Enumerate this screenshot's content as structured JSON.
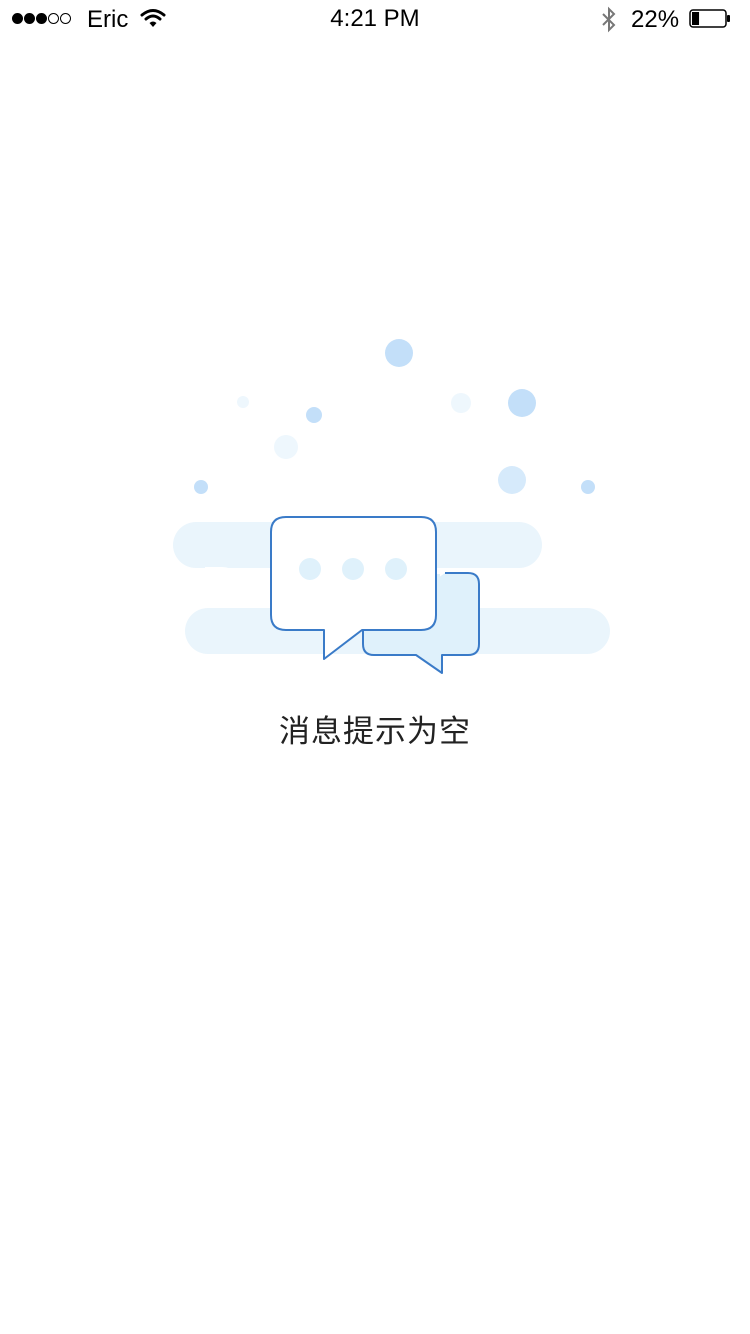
{
  "status_bar": {
    "carrier": "Eric",
    "time": "4:21 PM",
    "battery_percent": "22%",
    "battery_level": 0.22,
    "signal_bars": 3,
    "signal_total": 5,
    "icons": [
      "signal-dots-icon",
      "wifi-icon",
      "bluetooth-icon",
      "battery-icon"
    ]
  },
  "empty_state": {
    "message": "消息提示为空",
    "illustration": "chat-bubbles-icon"
  },
  "colors": {
    "accent_stroke": "#3a7bc8",
    "bubble_fill_light": "#dff1fb",
    "cloud": "#eaf5fc",
    "dot_blue": "#c3dff9"
  }
}
